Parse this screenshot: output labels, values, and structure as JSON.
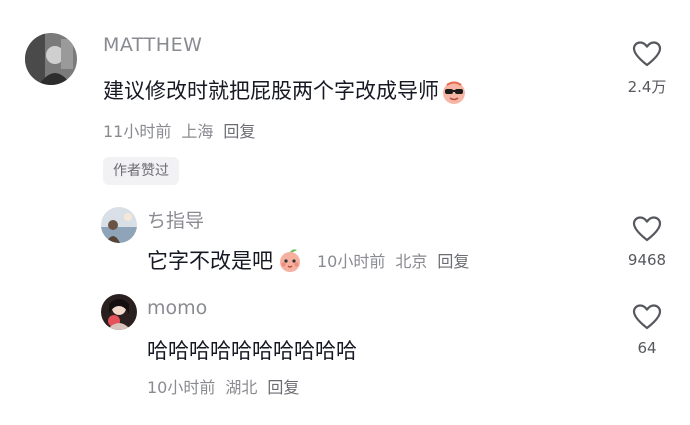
{
  "comments": [
    {
      "username": "MATTHEW",
      "text": "建议修改时就把屁股两个字改成导师",
      "emoji_icon": "cool-emoji-icon",
      "time": "11小时前",
      "location": "上海",
      "reply_label": "回复",
      "like_count": "2.4万",
      "badge": "作者赞过"
    },
    {
      "username": "ち指导",
      "text": "它字不改是吧",
      "emoji_icon": "peach-emoji-icon",
      "time": "10小时前",
      "location": "北京",
      "reply_label": "回复",
      "like_count": "9468"
    },
    {
      "username": "momo",
      "text": "哈哈哈哈哈哈哈哈哈哈",
      "time": "10小时前",
      "location": "湖北",
      "reply_label": "回复",
      "like_count": "64"
    }
  ],
  "colors": {
    "username": "#8a8b91",
    "text": "#161823",
    "meta": "#8a8b91",
    "badge_bg": "#f2f2f4"
  }
}
